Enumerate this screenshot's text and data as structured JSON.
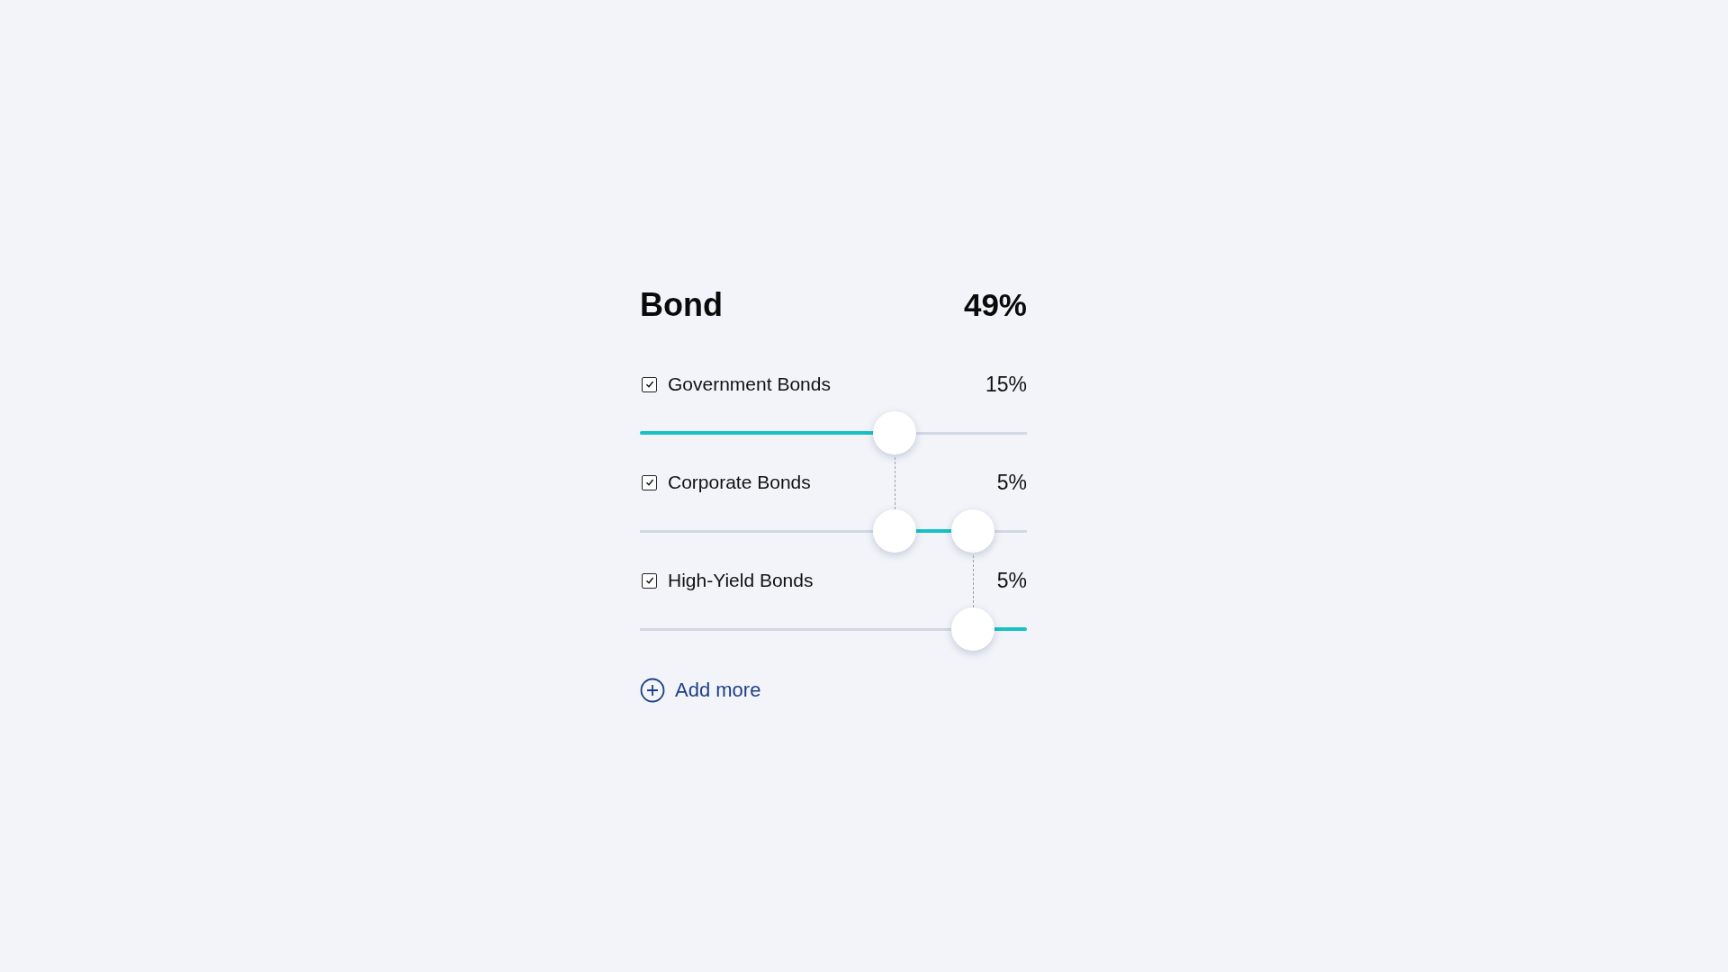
{
  "header": {
    "title": "Bond",
    "total": "49%"
  },
  "allocations": [
    {
      "label": "Government Bonds",
      "checked": true,
      "value": "15%",
      "level": 0.658
    },
    {
      "label": "Corporate Bonds",
      "checked": true,
      "value": "5%",
      "level": 0.86
    },
    {
      "label": "High-Yield Bonds",
      "checked": true,
      "value": "5%",
      "level": 1
    }
  ],
  "add_link": {
    "label": "Add more"
  }
}
